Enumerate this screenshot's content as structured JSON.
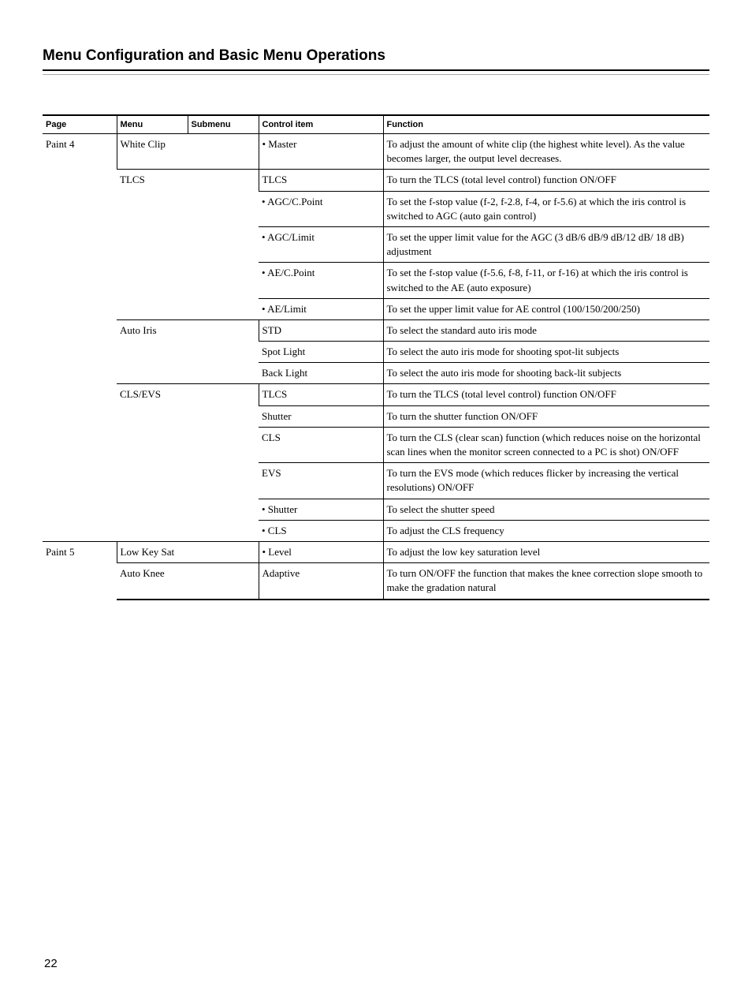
{
  "title": "Menu Configuration and Basic Menu Operations",
  "headers": {
    "page": "Page",
    "menu": "Menu",
    "submenu": "Submenu",
    "control": "Control item",
    "function": "Function"
  },
  "rows": [
    {
      "page": "Paint 4",
      "menu": "White Clip",
      "menuSpan": 2,
      "control": "• Master",
      "function": "To adjust the amount of white clip (the highest white level). As the value becomes larger, the output level decreases."
    },
    {
      "menu": "TLCS",
      "menuSpan": 2,
      "control": "TLCS",
      "function": "To turn the TLCS (total level control) function ON/OFF"
    },
    {
      "control": "• AGC/C.Point",
      "function": "To set the f-stop value (f-2, f-2.8, f-4, or f-5.6) at which the iris control is switched to AGC (auto gain control)"
    },
    {
      "control": "• AGC/Limit",
      "function": "To set the upper limit value for the AGC (3 dB/6 dB/9 dB/12 dB/ 18 dB) adjustment"
    },
    {
      "control": "• AE/C.Point",
      "function": "To set the f-stop value (f-5.6, f-8, f-11, or f-16) at which the iris control is switched to the AE (auto exposure)"
    },
    {
      "control": "• AE/Limit",
      "function": "To set the upper limit value for AE control (100/150/200/250)"
    },
    {
      "menu": "Auto Iris",
      "menuSpan": 2,
      "control": "STD",
      "function": "To select the standard auto iris mode"
    },
    {
      "control": "Spot Light",
      "function": "To select the auto iris mode for shooting spot-lit subjects"
    },
    {
      "control": "Back Light",
      "function": "To select the auto iris mode for shooting back-lit subjects"
    },
    {
      "menu": "CLS/EVS",
      "menuSpan": 2,
      "control": "TLCS",
      "function": "To turn the TLCS (total level control) function ON/OFF"
    },
    {
      "control": "Shutter",
      "function": "To turn the shutter function ON/OFF"
    },
    {
      "control": "CLS",
      "function": "To turn the CLS (clear scan) function (which reduces noise on the horizontal scan lines when the monitor screen connected to a PC is shot) ON/OFF"
    },
    {
      "control": "EVS",
      "function": "To turn the EVS mode (which reduces flicker by increasing the vertical resolutions) ON/OFF"
    },
    {
      "control": "• Shutter",
      "function": "To select the shutter speed"
    },
    {
      "control": "• CLS",
      "function": "To adjust the CLS frequency"
    },
    {
      "page": "Paint 5",
      "menu": "Low Key Sat",
      "menuSpan": 2,
      "control": "• Level",
      "function": "To adjust the low key saturation level"
    },
    {
      "menu": "Auto Knee",
      "menuSpan": 2,
      "control": "Adaptive",
      "function": "To turn ON/OFF the function that makes the knee correction slope smooth to make the gradation natural"
    }
  ],
  "pageNumber": "22"
}
